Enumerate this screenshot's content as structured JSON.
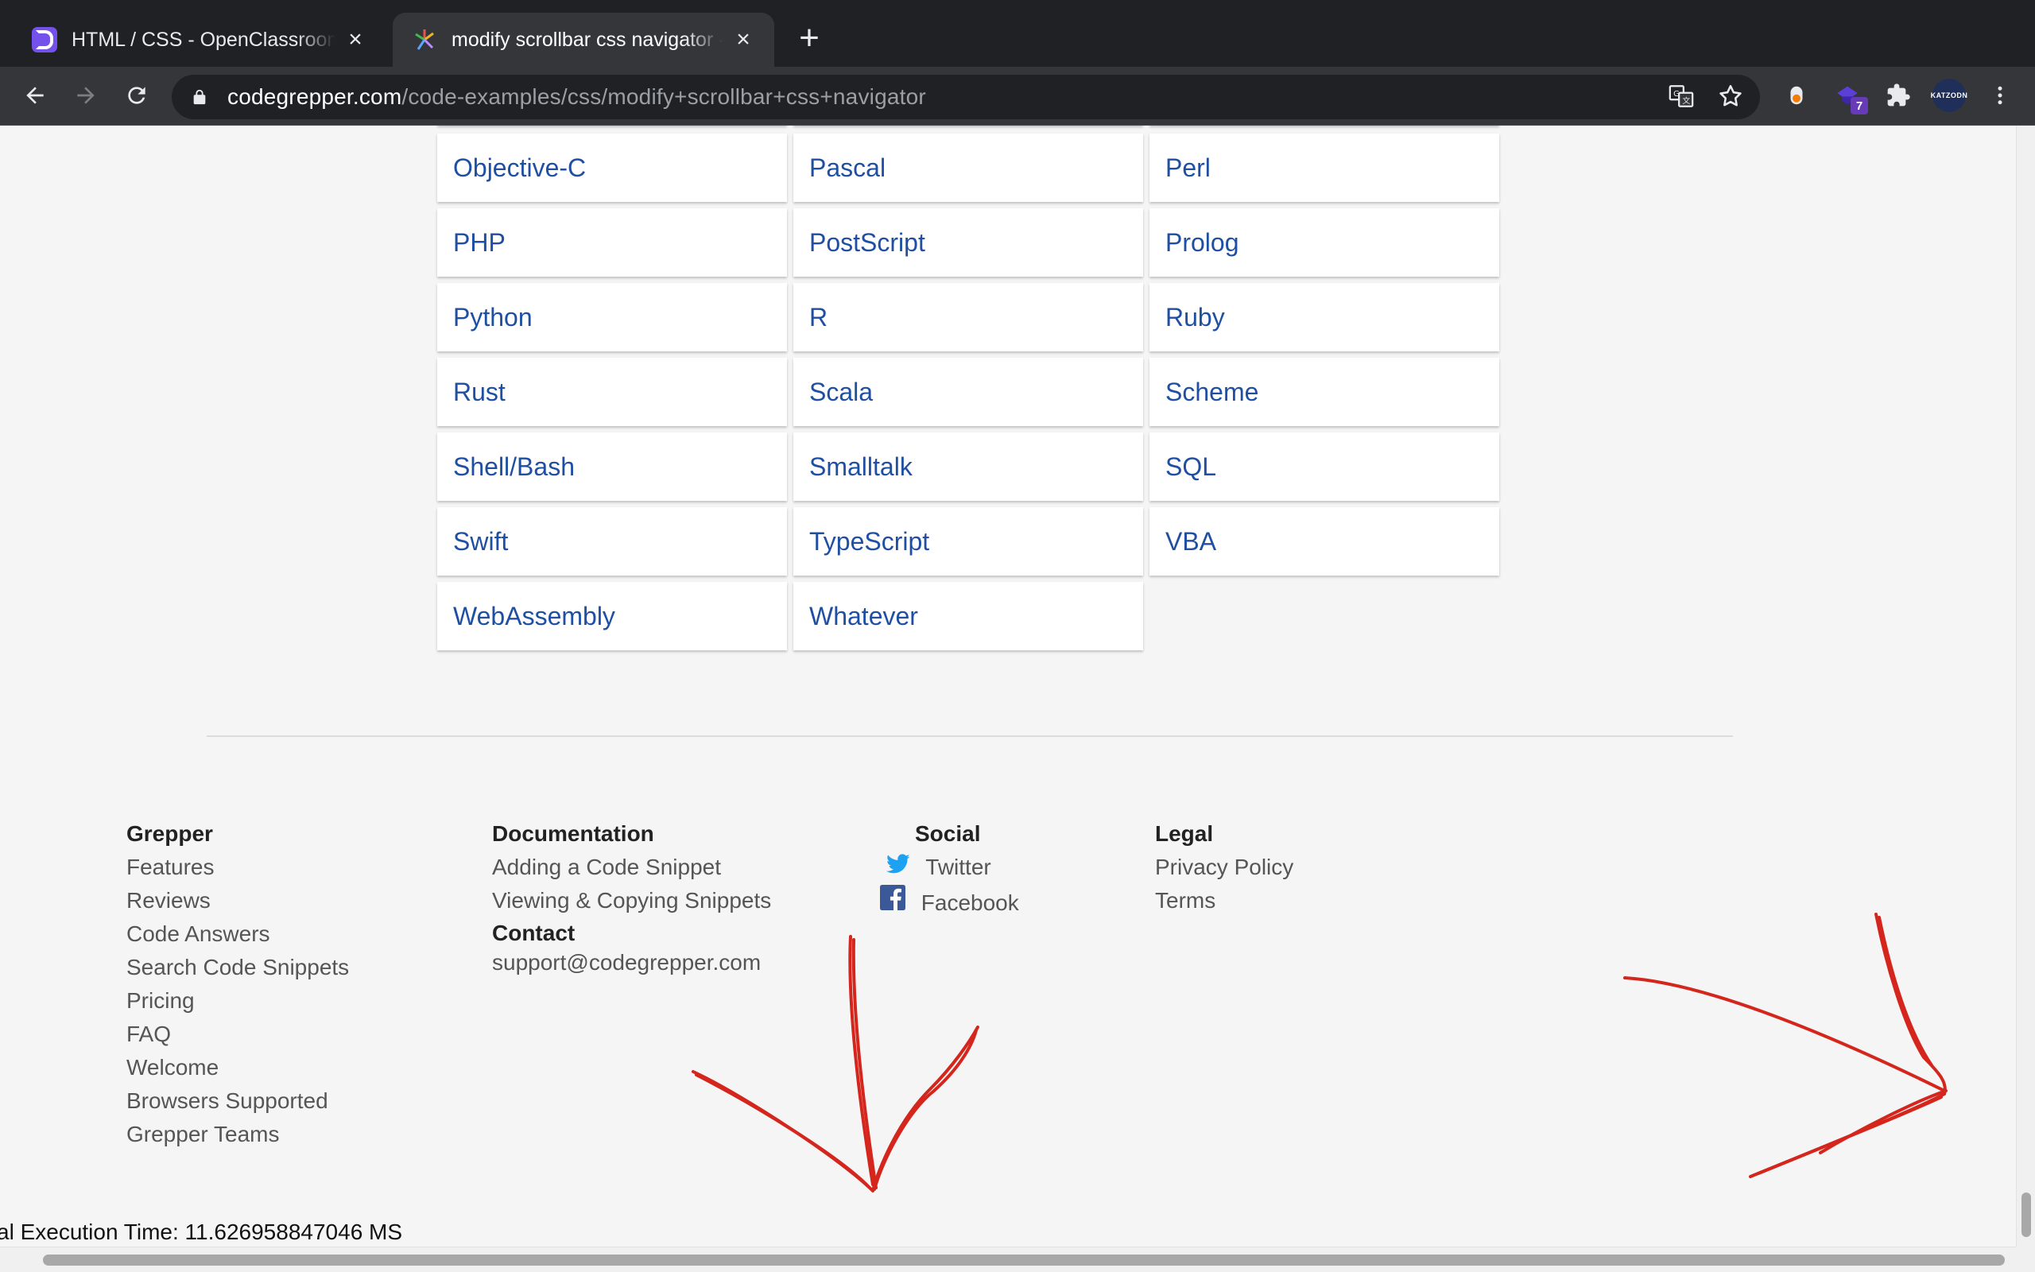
{
  "browser": {
    "tabs": [
      {
        "title": "HTML / CSS - OpenClassrooms",
        "active": false,
        "favicon": "openclassrooms-icon"
      },
      {
        "title": "modify scrollbar css navigator - Grepper",
        "active": true,
        "favicon": "grepper-icon"
      }
    ],
    "url": {
      "host": "codegrepper.com",
      "path": "/code-examples/css/modify+scrollbar+css+navigator"
    },
    "extension_badge": "7",
    "avatar_text": "KATZODN"
  },
  "languages": [
    "Objective-C",
    "Pascal",
    "Perl",
    "PHP",
    "PostScript",
    "Prolog",
    "Python",
    "R",
    "Ruby",
    "Rust",
    "Scala",
    "Scheme",
    "Shell/Bash",
    "Smalltalk",
    "SQL",
    "Swift",
    "TypeScript",
    "VBA",
    "WebAssembly",
    "Whatever"
  ],
  "footer": {
    "grepper": {
      "heading": "Grepper",
      "links": [
        "Features",
        "Reviews",
        "Code Answers",
        "Search Code Snippets",
        "Pricing",
        "FAQ",
        "Welcome",
        "Browsers Supported",
        "Grepper Teams"
      ]
    },
    "documentation": {
      "heading": "Documentation",
      "links": [
        "Adding a Code Snippet",
        "Viewing & Copying Snippets"
      ],
      "contact_heading": "Contact",
      "contact_email": "support@codegrepper.com"
    },
    "social": {
      "heading": "Social",
      "twitter": "Twitter",
      "facebook": "Facebook"
    },
    "legal": {
      "heading": "Legal",
      "links": [
        "Privacy Policy",
        "Terms"
      ]
    }
  },
  "execution_time": "al Execution Time: 11.626958847046 MS",
  "colors": {
    "link_blue": "#1f4fa3",
    "annotation_red": "#d4261c",
    "twitter": "#1da1f2",
    "facebook": "#3b5998"
  }
}
